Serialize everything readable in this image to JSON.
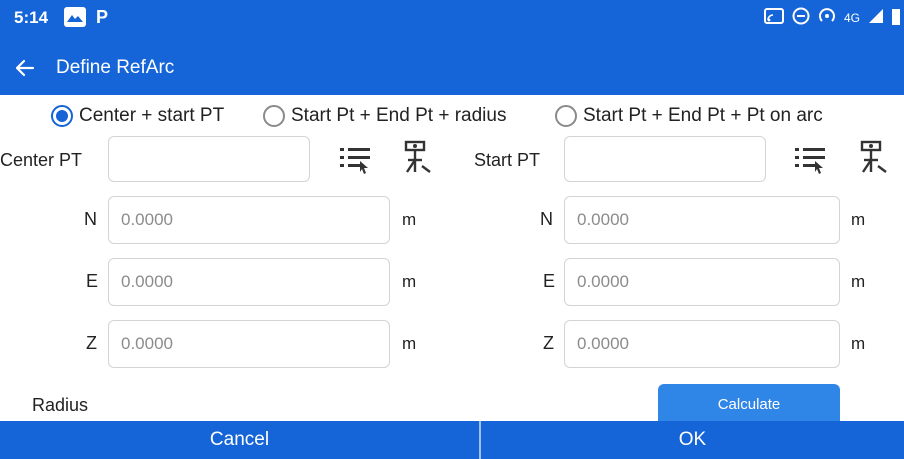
{
  "status": {
    "time": "5:14",
    "network": "4G"
  },
  "header": {
    "title": "Define RefArc"
  },
  "modes": [
    {
      "label": "Center + start PT",
      "selected": true
    },
    {
      "label": "Start Pt + End Pt + radius",
      "selected": false
    },
    {
      "label": "Start Pt + End Pt + Pt on arc",
      "selected": false
    }
  ],
  "left": {
    "point_label": "Center PT",
    "point_value": "",
    "n_label": "N",
    "n_placeholder": "0.0000",
    "e_label": "E",
    "e_placeholder": "0.0000",
    "z_label": "Z",
    "z_placeholder": "0.0000",
    "unit": "m"
  },
  "right": {
    "point_label": "Start PT",
    "point_value": "",
    "n_label": "N",
    "n_placeholder": "0.0000",
    "e_label": "E",
    "e_placeholder": "0.0000",
    "z_label": "Z",
    "z_placeholder": "0.0000",
    "unit": "m"
  },
  "radius_label": "Radius",
  "calculate_label": "Calculate",
  "cancel_label": "Cancel",
  "ok_label": "OK",
  "colors": {
    "primary": "#1565d8",
    "button": "#2f86e6"
  }
}
